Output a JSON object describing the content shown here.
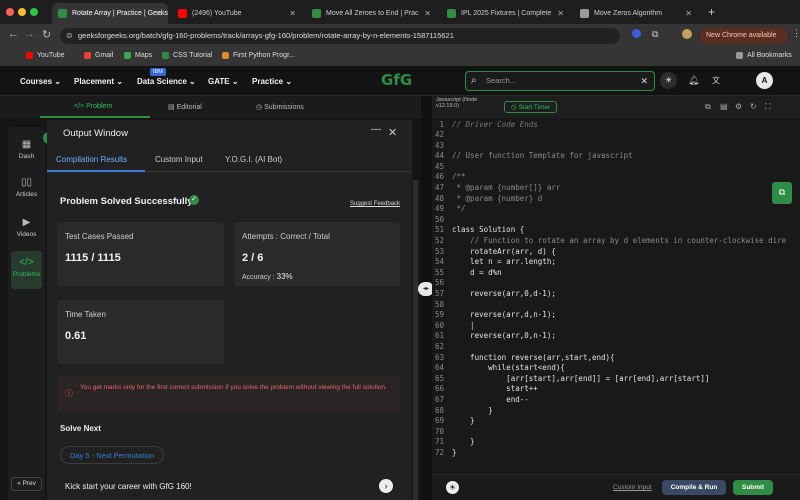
{
  "browser": {
    "tabs": [
      {
        "label": "Rotate Array | Practice | Geeks",
        "color": "#2f8d46"
      },
      {
        "label": "(2496) YouTube",
        "color": "#ff0000"
      },
      {
        "label": "Move All Zeroes to End | Prac",
        "color": "#2f8d46"
      },
      {
        "label": "IPL 2025 Fixtures | Complete",
        "color": "#2f8d46"
      },
      {
        "label": "Move Zeros Algorithm",
        "color": "#9a9a9a"
      }
    ],
    "url": "geeksforgeeks.org/batch/gfg-160-problems/track/arrays-gfg-160/problem/rotate-array-by-n-elements-1587115621",
    "update_label": "New Chrome available",
    "profile_initial": "A",
    "bookmarks": [
      "YouTube",
      "Gmail",
      "Maps",
      "CSS Tutorial",
      "First Python Progr...",
      "All Bookmarks"
    ]
  },
  "site_nav": {
    "items": [
      "Courses",
      "Placement",
      "Data Science",
      "GATE",
      "Practice"
    ],
    "ibm_badge": "IBM",
    "logo": "GfG",
    "search_placeholder": "Search...",
    "avatar": "A"
  },
  "problem_tabs": [
    "Problem",
    "Editorial",
    "Submissions"
  ],
  "sidebar": [
    {
      "label": "Dash",
      "icon": "dashboard-icon"
    },
    {
      "label": "Articles",
      "icon": "book-icon"
    },
    {
      "label": "Videos",
      "icon": "video-icon"
    },
    {
      "label": "Problems",
      "icon": "code-icon"
    }
  ],
  "prev_label": "Prev",
  "output": {
    "title": "Output Window",
    "tabs": [
      "Compilation Results",
      "Custom Input",
      "Y.O.G.I. (AI Bot)"
    ],
    "status": "Problem Solved Successfully",
    "suggest": "Suggest Feedback",
    "tests_label": "Test Cases Passed",
    "tests_value": "1115 / 1115",
    "attempts_label": "Attempts : Correct / Total",
    "attempts_value": "2 / 6",
    "accuracy_label": "Accuracy :",
    "accuracy_value": "33%",
    "time_label": "Time Taken",
    "time_value": "0.61",
    "notice": "You get marks only for the first correct submission if you solve the problem without viewing the full solution.",
    "solve_next": "Solve Next",
    "next_problem": "Day 5 - Next Permutation",
    "kickstart": "Kick start your career with GfG 160!"
  },
  "editor": {
    "language": "Javascript (Node v12.19.0)",
    "timer": "Start Timer",
    "custom_input": "Custom Input",
    "compile_run": "Compile & Run",
    "submit": "Submit",
    "lines": [
      {
        "n": "42",
        "t": ""
      },
      {
        "n": "43",
        "t": ""
      },
      {
        "n": "44",
        "t": "// User function Template for javascript",
        "c": "#8a8a8a"
      },
      {
        "n": "45",
        "t": ""
      },
      {
        "n": "46",
        "t": "/**",
        "c": "#8a8a8a"
      },
      {
        "n": "47",
        "t": " * @param {number[]} arr",
        "c": "#8a8a8a"
      },
      {
        "n": "48",
        "t": " * @param {number} d",
        "c": "#8a8a8a"
      },
      {
        "n": "49",
        "t": " */",
        "c": "#8a8a8a"
      },
      {
        "n": "50",
        "t": ""
      },
      {
        "n": "51",
        "t": "class Solution {"
      },
      {
        "n": "52",
        "t": "    // Function to rotate an array by d elements in counter-clockwise dire",
        "c": "#8a8a8a"
      },
      {
        "n": "53",
        "t": "    rotateArr(arr, d) {"
      },
      {
        "n": "54",
        "t": "    let n = arr.length;"
      },
      {
        "n": "55",
        "t": "    d = d%n"
      },
      {
        "n": "56",
        "t": ""
      },
      {
        "n": "57",
        "t": "    reverse(arr,0,d-1);"
      },
      {
        "n": "58",
        "t": ""
      },
      {
        "n": "59",
        "t": "    reverse(arr,d,n-1);"
      },
      {
        "n": "60",
        "t": "    |",
        "c": "#cfcfcf"
      },
      {
        "n": "61",
        "t": "    reverse(arr,0,n-1);"
      },
      {
        "n": "62",
        "t": ""
      },
      {
        "n": "63",
        "t": "    function reverse(arr,start,end){"
      },
      {
        "n": "64",
        "t": "        while(start<end){"
      },
      {
        "n": "65",
        "t": "            [arr[start],arr[end]] = [arr[end],arr[start]]"
      },
      {
        "n": "66",
        "t": "            start++"
      },
      {
        "n": "67",
        "t": "            end--"
      },
      {
        "n": "68",
        "t": "        }"
      },
      {
        "n": "69",
        "t": "    }"
      },
      {
        "n": "70",
        "t": ""
      },
      {
        "n": "71",
        "t": "    }"
      },
      {
        "n": "72",
        "t": "}"
      }
    ],
    "header_line": {
      "n": "1",
      "t": "// Driver Code Ends"
    }
  }
}
